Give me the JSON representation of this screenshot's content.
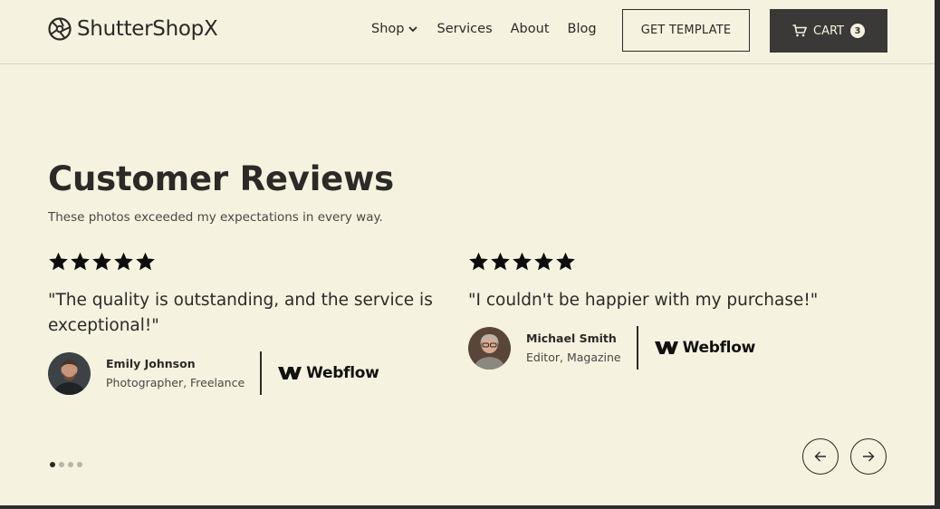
{
  "brand": {
    "name": "ShutterShopX",
    "icon": "camera-aperture-icon"
  },
  "nav": {
    "items": [
      {
        "label": "Shop",
        "has_dropdown": true
      },
      {
        "label": "Services"
      },
      {
        "label": "About"
      },
      {
        "label": "Blog"
      }
    ]
  },
  "header": {
    "template_button": "GET TEMPLATE",
    "cart_label": "CART",
    "cart_count": "3"
  },
  "section": {
    "title": "Customer Reviews",
    "subtitle": "These photos exceeded my expectations in every way."
  },
  "reviews": [
    {
      "rating": 5,
      "quote": "\"The quality is outstanding, and the service is exceptional!\"",
      "author": "Emily Johnson",
      "role": "Photographer, Freelance",
      "company": "Webflow"
    },
    {
      "rating": 5,
      "quote": "\"I couldn't be happier with my purchase!\"",
      "author": "Michael Smith",
      "role": "Editor, Magazine",
      "company": "Webflow"
    }
  ],
  "slider": {
    "page_count": 4,
    "active_index": 0
  },
  "colors": {
    "background": "#f5f2df",
    "text": "#2b2a27",
    "button_dark": "#3a3937"
  }
}
